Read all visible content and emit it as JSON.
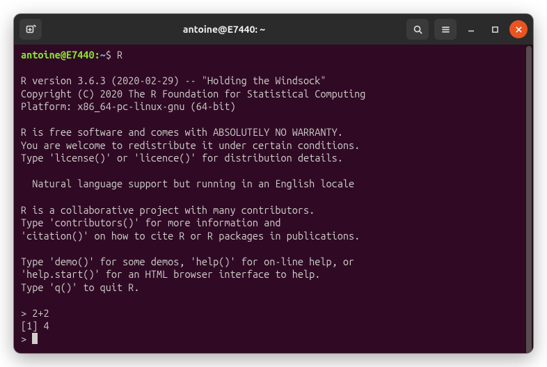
{
  "titlebar": {
    "title": "antoine@E7440: ~",
    "new_tab_tooltip": "New Tab",
    "search_tooltip": "Search",
    "menu_tooltip": "Menu",
    "minimize_tooltip": "Minimize",
    "maximize_tooltip": "Maximize",
    "close_tooltip": "Close"
  },
  "prompt": {
    "user_host": "antoine@E7440",
    "colon": ":",
    "path": "~",
    "dollar": "$ ",
    "command": "R"
  },
  "lines": {
    "l1": "R version 3.6.3 (2020-02-29) -- \"Holding the Windsock\"",
    "l2": "Copyright (C) 2020 The R Foundation for Statistical Computing",
    "l3": "Platform: x86_64-pc-linux-gnu (64-bit)",
    "l4": "R is free software and comes with ABSOLUTELY NO WARRANTY.",
    "l5": "You are welcome to redistribute it under certain conditions.",
    "l6": "Type 'license()' or 'licence()' for distribution details.",
    "l7": "  Natural language support but running in an English locale",
    "l8": "R is a collaborative project with many contributors.",
    "l9": "Type 'contributors()' for more information and",
    "l10": "'citation()' on how to cite R or R packages in publications.",
    "l11": "Type 'demo()' for some demos, 'help()' for on-line help, or",
    "l12": "'help.start()' for an HTML browser interface to help.",
    "l13": "Type 'q()' to quit R.",
    "l14": "> 2+2",
    "l15": "[1] 4",
    "l16": "> "
  }
}
